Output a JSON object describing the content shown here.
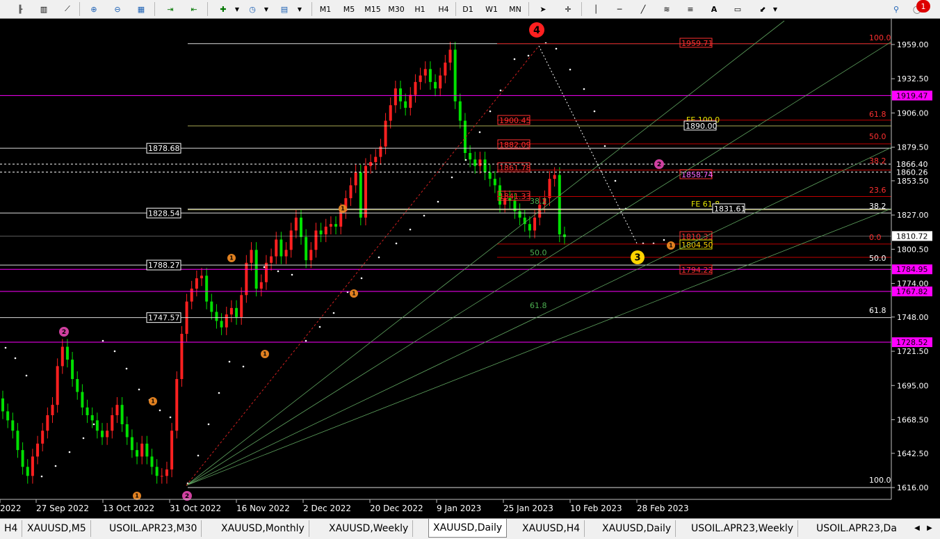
{
  "toolbar": {
    "timeframes": [
      "M1",
      "M5",
      "M15",
      "M30",
      "H1",
      "H4",
      "D1",
      "W1",
      "MN"
    ],
    "notification_count": "1"
  },
  "chart": {
    "price_axis": [
      "1959.00",
      "1932.50",
      "1906.00",
      "1879.50",
      "1853.50",
      "1827.00",
      "1800.50",
      "1774.00",
      "1748.00",
      "1721.50",
      "1695.00",
      "1668.50",
      "1642.50",
      "1616.00"
    ],
    "time_axis": [
      "2022",
      "27 Sep 2022",
      "13 Oct 2022",
      "31 Oct 2022",
      "16 Nov 2022",
      "2 Dec 2022",
      "20 Dec 2022",
      "9 Jan 2023",
      "25 Jan 2023",
      "10 Feb 2023",
      "28 Feb 2023"
    ],
    "horizontal_levels": {
      "magenta": [
        "1919.47",
        "1784.95",
        "1767.82",
        "1728.52"
      ],
      "current_price": "1810.72",
      "dashed_upper": "1866.40",
      "dashed_lower": "1860.26",
      "boxed_left": [
        "1878.68",
        "1828.54",
        "1788.27",
        "1747.57"
      ]
    },
    "fib_right": [
      "100.0",
      "61.8",
      "50.0",
      "38.2",
      "23.6",
      "0.0",
      "38.2",
      "50.0",
      "61.8",
      "100.0"
    ],
    "fib_red_boxes": [
      "1959.71",
      "1900.45",
      "1882.09",
      "1861.78",
      "1841.33",
      "1858.74",
      "1794.22",
      "1810.33"
    ],
    "fib_fan_labels": [
      "38.2",
      "50.0",
      "61.8"
    ],
    "fe_labels": [
      "FE 100.0",
      "FE 61.8"
    ],
    "white_boxes": [
      "1890.00",
      "1831.61"
    ],
    "yellow_box": "1804.50",
    "wave_labels": {
      "w4": "4",
      "w3": "3",
      "o1": "1",
      "o2": "2"
    }
  },
  "tabs": [
    "H4",
    "XAUUSD,M5",
    "USOIL.APR23,M30",
    "XAUUSD,Monthly",
    "XAUUSD,Weekly",
    "XAUUSD,Daily",
    "XAUUSD,H4",
    "XAUUSD,Daily",
    "USOIL.APR23,Weekly",
    "USOIL.APR23,Da"
  ],
  "active_tab_index": 5
}
